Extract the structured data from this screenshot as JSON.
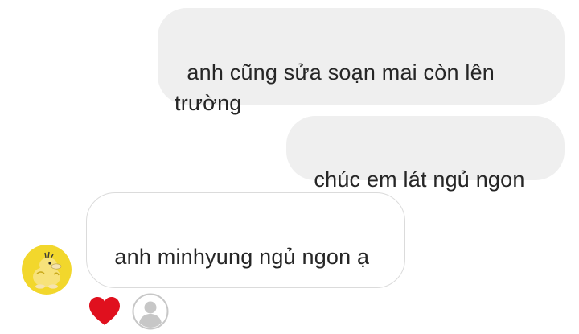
{
  "conversation": {
    "messages": [
      {
        "sender": "me",
        "text": "anh cũng sửa soạn mai còn lên trường"
      },
      {
        "sender": "me",
        "text": "chúc em lát ngủ ngon"
      },
      {
        "sender": "them",
        "text": "anh minhyung ngủ ngon ạ"
      }
    ],
    "reaction": {
      "icon": "heart-icon",
      "color": "#e0101e"
    },
    "seen_indicator": {
      "icon": "default-avatar-icon"
    },
    "contact_avatar": {
      "icon": "psyduck-avatar-icon",
      "color": "#f2d72c"
    }
  }
}
